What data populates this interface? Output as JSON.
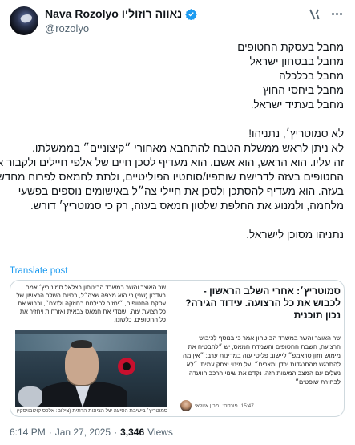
{
  "author": {
    "display_name": "Nava Rozolyo נאווה רוזוליו",
    "handle": "@rozolyo",
    "verified": true
  },
  "icons": {
    "avatar": "profile-avatar",
    "verified": "verified-badge-icon",
    "grok": "grok-icon",
    "more": "more-options-icon"
  },
  "colors": {
    "accent": "#1d9bf0",
    "secondary_text": "#536471",
    "border": "#cfd9de"
  },
  "tweet": {
    "lines": [
      "מחבל בעסקת החטופים",
      "מחבל בבטחון ישראל",
      "מחבל בכלכלה",
      "מחבל ביחסי החוץ",
      "מחבל בעתיד ישראל.",
      "",
      "לא סמוטריץ׳, נתניהו!",
      "לא ניתן לראש ממשלת הטבח להתחבא מאחורי ״קיצוניים״ בממשלתו.",
      "זה עליו. הוא הראש, הוא אשם. הוא מעדיף לסכן חיים של אלפי חיילים ולקבור את",
      "החטופים בעזה לדרישת שותפיו/סוחטיו הפוליטיים, ולתת לחמאס לפרוח מחדש",
      "בעזה. הוא מעדיף להסתכן ולסכן את חיילי צה״ל באישומים נוספים בפשעי",
      "מלחמה, ולמנוע את החלפת שלטון חמאס בעזה, רק כי סמוטריץ׳ דורש.",
      "",
      "נתניהו מסוכן לישראל."
    ],
    "translate_label": "Translate post",
    "time": "6:14 PM",
    "separator": "·",
    "date": "Jan 27, 2025",
    "views_count": "3,346",
    "views_label": "Views"
  },
  "card": {
    "caption_top": "שר האוצר והשר במשרד הביטחון בצלאל סמוטריץ׳ אמר בעדכון (שני) כי הוא מצפה שצה״ל, בסיום השלב הראשון של עסקת החטופים, ״יחזור להילחם בחוזקה ולנצח״, וכבוש את כל רצועת עזה, ושמדי את חמאס צבאית ואזרחית ויחזיר את כל החטופים, כלשונו.",
    "photo_caption": "סמוטריץ׳ בישיבת הסיעה של הציונות הדתית (צילום: אלכס קולומויסקי)",
    "title": "סמוטריץ׳: אחרי השלב הראשון - לכבוש את כל הרצועה. עידוד הגירה? נכון תוכנית",
    "body": "שר האוצר והשר במשרד הביטחון אמר כי בנוסף לכיבוש הרצועה, השבת החטופים והשמדת חמאס, יש ״להבטיח את מימוש חזון טראמפ״ ליישוב פליטי עזה במדינות ערב: ״אין מה להתרגש מהתנגדות ירדן ומצרים״. על מינוי יצחק עמית: ״לא נשלים עם המצב המעוות הזה. נקדם את שינוי הרכב הוועדה לבחירת שופטים״",
    "author": "מרון אזולאי",
    "published_label": "פורסם:",
    "published_time": "15:47"
  }
}
